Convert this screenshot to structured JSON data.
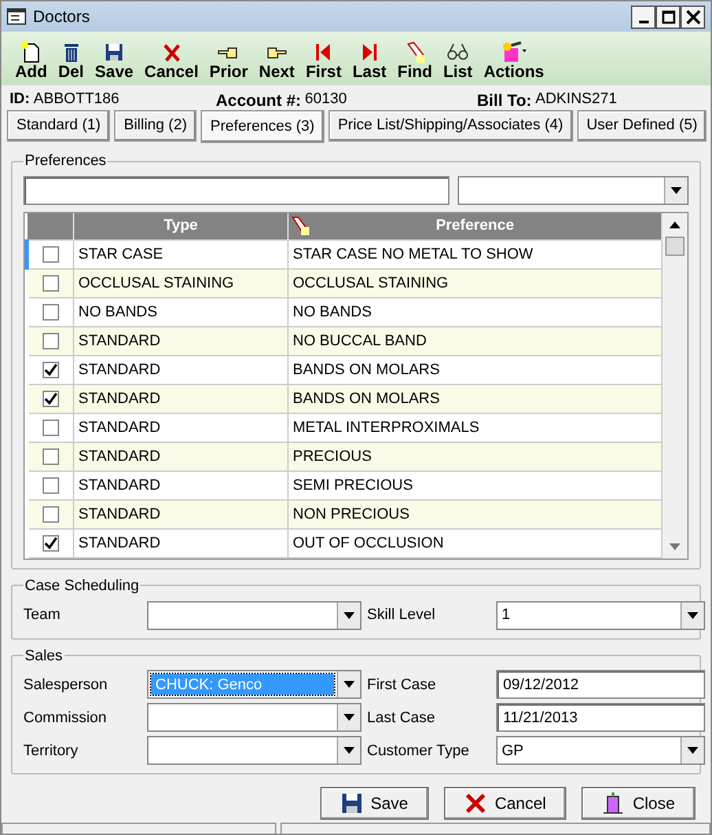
{
  "window": {
    "title": "Doctors"
  },
  "toolbar": [
    {
      "label": "Add"
    },
    {
      "label": "Del"
    },
    {
      "label": "Save"
    },
    {
      "label": "Cancel"
    },
    {
      "label": "Prior"
    },
    {
      "label": "Next"
    },
    {
      "label": "First"
    },
    {
      "label": "Last"
    },
    {
      "label": "Find"
    },
    {
      "label": "List"
    },
    {
      "label": "Actions"
    }
  ],
  "info": [
    {
      "label": "ID:",
      "value": "ABBOTT186"
    },
    {
      "label": "Account #:",
      "value": "60130"
    },
    {
      "label": "Bill To:",
      "value": "ADKINS271"
    }
  ],
  "tabs": [
    {
      "label": "Standard (1)",
      "selected": false
    },
    {
      "label": "Billing (2)",
      "selected": false
    },
    {
      "label": "Preferences (3)",
      "selected": true
    },
    {
      "label": "Price List/Shipping/Associates (4)",
      "selected": false
    },
    {
      "label": "User Defined (5)",
      "selected": false
    }
  ],
  "preferences": {
    "title": "Preferences",
    "columns": [
      "Type",
      "Preference"
    ],
    "rows": [
      {
        "checked": false,
        "selected": true,
        "type": "STAR CASE",
        "preference": "STAR CASE NO METAL TO SHOW"
      },
      {
        "checked": false,
        "selected": false,
        "type": "OCCLUSAL STAINING",
        "preference": "OCCLUSAL STAINING"
      },
      {
        "checked": false,
        "selected": false,
        "type": "NO BANDS",
        "preference": "NO BANDS"
      },
      {
        "checked": false,
        "selected": false,
        "type": "STANDARD",
        "preference": "NO BUCCAL BAND"
      },
      {
        "checked": true,
        "selected": false,
        "type": "STANDARD",
        "preference": "BANDS ON MOLARS"
      },
      {
        "checked": true,
        "selected": false,
        "type": "STANDARD",
        "preference": "BANDS ON MOLARS"
      },
      {
        "checked": false,
        "selected": false,
        "type": "STANDARD",
        "preference": "METAL INTERPROXIMALS"
      },
      {
        "checked": false,
        "selected": false,
        "type": "STANDARD",
        "preference": "PRECIOUS"
      },
      {
        "checked": false,
        "selected": false,
        "type": "STANDARD",
        "preference": "SEMI PRECIOUS"
      },
      {
        "checked": false,
        "selected": false,
        "type": "STANDARD",
        "preference": "NON PRECIOUS"
      },
      {
        "checked": true,
        "selected": false,
        "type": "STANDARD",
        "preference": "OUT OF OCCLUSION"
      }
    ]
  },
  "case_scheduling": {
    "title": "Case Scheduling",
    "fields": [
      {
        "label": "Team",
        "kind": "select",
        "focused": false
      },
      {
        "label": "Skill Level",
        "value": "1",
        "kind": "select",
        "focused": false
      }
    ]
  },
  "sales": {
    "title": "Sales",
    "fields": [
      {
        "label": "Salesperson",
        "value": "CHUCK: Genco",
        "kind": "select",
        "focused": true
      },
      {
        "label": "First Case",
        "value": "09/12/2012",
        "kind": "text",
        "focused": false
      },
      {
        "label": "Commission",
        "kind": "select",
        "focused": false
      },
      {
        "label": "Last Case",
        "value": "11/21/2013",
        "kind": "text",
        "focused": false
      },
      {
        "label": "Territory",
        "kind": "select",
        "focused": false
      },
      {
        "label": "Customer Type",
        "value": "GP",
        "kind": "select",
        "focused": false
      }
    ]
  },
  "buttons": [
    {
      "label": "Save"
    },
    {
      "label": "Cancel"
    },
    {
      "label": "Close"
    }
  ]
}
